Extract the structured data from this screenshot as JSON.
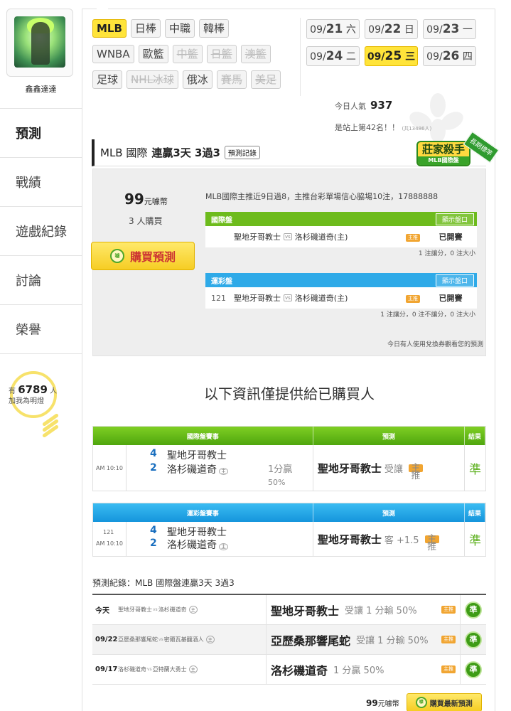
{
  "user": {
    "name": "鑫鑫達達"
  },
  "nav": [
    "預測",
    "戰績",
    "遊戲紀錄",
    "討論",
    "榮譽"
  ],
  "fans": {
    "prefix": "有",
    "count": "6789",
    "suffix": "人",
    "line2": "加我為明燈"
  },
  "tags": [
    [
      {
        "label": "MLB",
        "state": "on"
      },
      {
        "label": "日棒",
        "state": "normal"
      },
      {
        "label": "中職",
        "state": "normal"
      },
      {
        "label": "韓棒",
        "state": "normal"
      }
    ],
    [
      {
        "label": "WNBA",
        "state": "normal"
      },
      {
        "label": "歐籃",
        "state": "normal"
      },
      {
        "label": "中籃",
        "state": "off"
      },
      {
        "label": "日籃",
        "state": "off"
      },
      {
        "label": "澳籃",
        "state": "off"
      }
    ],
    [
      {
        "label": "足球",
        "state": "normal"
      },
      {
        "label": "NHL冰球",
        "state": "off"
      },
      {
        "label": "俄冰",
        "state": "normal"
      },
      {
        "label": "賽馬",
        "state": "off"
      },
      {
        "label": "美足",
        "state": "off"
      }
    ]
  ],
  "dates": [
    [
      {
        "md": "09/",
        "d": "21",
        "w": "六",
        "on": false
      },
      {
        "md": "09/",
        "d": "22",
        "w": "日",
        "on": false
      },
      {
        "md": "09/",
        "d": "23",
        "w": "一",
        "on": false
      }
    ],
    [
      {
        "md": "09/",
        "d": "24",
        "w": "二",
        "on": false
      },
      {
        "md": "09/",
        "d": "25",
        "w": "三",
        "on": true
      },
      {
        "md": "09/",
        "d": "26",
        "w": "四",
        "on": false
      }
    ]
  ],
  "popularity": {
    "label": "今日人氣",
    "value": "937"
  },
  "rank": {
    "text": "是站上第42名！！",
    "small": "(共13486人)"
  },
  "section": {
    "league": "MLB 國際",
    "streak": "連贏3天 3過3",
    "record_btn": "預測記錄"
  },
  "badge": {
    "main": "莊家殺手",
    "sub": "MLB國際盤",
    "ribbon": "長期標竿"
  },
  "detail": {
    "price": "99",
    "price_unit": "元噱幣",
    "buyers": "3 人購買",
    "buy_btn": "購買預測",
    "coin": "噱",
    "rec_text": "MLB國際主推近9日過8，主推台彩單場信心脇場10注，17888888",
    "markets": [
      {
        "name": "國際盤",
        "color": "green",
        "show": "顯示盤口",
        "id": "",
        "home": "聖地牙哥教士",
        "away": "洛杉磯道奇(主)",
        "status": "已開賽",
        "note": "1 注讓分，0 注大小"
      },
      {
        "name": "運彩盤",
        "color": "blue",
        "show": "顯示盤口",
        "id": "121",
        "home": "聖地牙哥教士",
        "away": "洛杉磯道奇(主)",
        "status": "已開賽",
        "note": "1 注讓分，0 注不讓分，0 注大小"
      }
    ],
    "vs": "vs",
    "icon_label": "主推",
    "coupon_note": "今日有人使用兌換券觀看您的預測"
  },
  "info_title": "以下資訊僅提供給已購買人",
  "tables": [
    {
      "head": [
        "國際盤賽事",
        "預測",
        "結果"
      ],
      "id": "",
      "time": "AM 10:10",
      "s1": "4",
      "t1": "聖地牙哥教士",
      "s2": "2",
      "t2": "洛杉磯道奇",
      "host": "主",
      "spread1": "1分贏",
      "spread2": "50%",
      "pick": "聖地牙哥教士",
      "pick_note": "受讓",
      "result": "準"
    },
    {
      "head": [
        "運彩盤賽事",
        "預測",
        "結果"
      ],
      "id": "121",
      "time": "AM 10:10",
      "s1": "4",
      "t1": "聖地牙哥教士",
      "s2": "2",
      "t2": "洛杉磯道奇",
      "host": "主",
      "spread1": "",
      "spread2": "",
      "pick": "聖地牙哥教士",
      "pick_note": "客 +1.5",
      "result": "準"
    }
  ],
  "history": {
    "title": "預測紀錄：MLB 國際盤連贏3天 3過3",
    "rows": [
      {
        "date": "今天",
        "match": "聖地牙哥教士",
        "vs": "vs",
        "match2": "洛杉磯道奇",
        "host": "主",
        "pick": "聖地牙哥教士",
        "note": "受讓 1 分輸 50%",
        "res": "準"
      },
      {
        "date": "09/22",
        "match": "亞歷桑那響尾蛇",
        "vs": "vs",
        "match2": "密爾瓦基釀酒人",
        "host": "主",
        "pick": "亞歷桑那響尾蛇",
        "note": "受讓 1 分輸 50%",
        "res": "準"
      },
      {
        "date": "09/17",
        "match": "洛杉磯道奇",
        "vs": "vs",
        "match2": "亞特蘭大勇士",
        "host": "主",
        "pick": "洛杉磯道奇",
        "note": "1 分贏 50%",
        "res": "準"
      }
    ]
  },
  "footer": {
    "price": "99",
    "unit": "元噱幣",
    "btn": "購買最新預測"
  }
}
